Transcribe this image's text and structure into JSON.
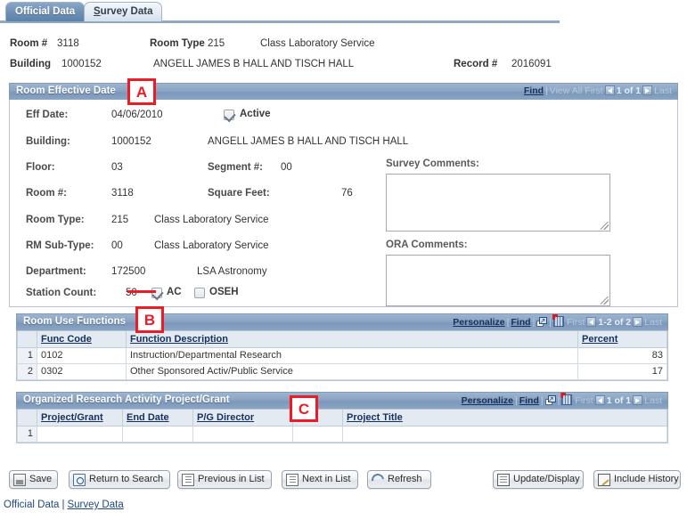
{
  "tabs": [
    {
      "label": "Official Data",
      "active": true
    },
    {
      "label": "Survey Data",
      "active": false,
      "accel": "S"
    }
  ],
  "header": {
    "room_label": "Room #",
    "room_value": "3118",
    "room_type_label": "Room Type",
    "room_type_value": "215",
    "room_type_desc": "Class Laboratory Service",
    "building_label": "Building",
    "building_value": "1000152",
    "building_desc": "ANGELL JAMES B HALL AND TISCH HALL",
    "record_label": "Record #",
    "record_value": "2016091"
  },
  "effective_section": {
    "title": "Room Effective Date",
    "nav": {
      "find": "Find",
      "view_all": "View All",
      "first": "First",
      "counter": "1 of 1",
      "last": "Last"
    },
    "fields": {
      "eff_date_label": "Eff Date:",
      "eff_date_value": "04/06/2010",
      "active_label": "Active",
      "active_checked": true,
      "building_label": "Building:",
      "building_value": "1000152",
      "building_desc": "ANGELL JAMES B HALL AND TISCH HALL",
      "floor_label": "Floor:",
      "floor_value": "03",
      "segment_label": "Segment #:",
      "segment_value": "00",
      "room_label": "Room #:",
      "room_value": "3118",
      "sqft_label": "Square Feet:",
      "sqft_value": "76",
      "room_type_label": "Room Type:",
      "room_type_value": "215",
      "room_type_desc": "Class Laboratory Service",
      "sub_type_label": "RM Sub-Type:",
      "sub_type_value": "00",
      "sub_type_desc": "Class Laboratory Service",
      "department_label": "Department:",
      "department_value": "172500",
      "department_desc": "LSA Astronomy",
      "station_count_label": "Station Count:",
      "station_count_value": "50",
      "ac_label": "AC",
      "ac_checked": true,
      "oseh_label": "OSEH",
      "oseh_checked": false
    },
    "survey_comments_label": "Survey Comments:",
    "survey_comments_value": "",
    "ora_comments_label": "ORA Comments:",
    "ora_comments_value": ""
  },
  "room_use_functions": {
    "title": "Room Use Functions",
    "nav": {
      "personalize": "Personalize",
      "find": "Find",
      "popup_icon": "popup-window-icon",
      "grid_icon": "download-spreadsheet-icon",
      "first": "First",
      "counter": "1-2 of 2",
      "last": "Last"
    },
    "columns": [
      "",
      "Func Code",
      "Function Description",
      "Percent"
    ],
    "rows": [
      {
        "num": "1",
        "func_code": "0102",
        "description": "Instruction/Departmental Research",
        "percent": "83"
      },
      {
        "num": "2",
        "func_code": "0302",
        "description": "Other Sponsored Activ/Public Service",
        "percent": "17"
      }
    ]
  },
  "org_research": {
    "title": "Organized Research Activity Project/Grant",
    "nav": {
      "personalize": "Personalize",
      "find": "Find",
      "popup_icon": "popup-window-icon",
      "grid_icon": "download-spreadsheet-icon",
      "first": "First",
      "counter": "1 of 1",
      "last": "Last"
    },
    "columns": [
      "",
      "Project/Grant",
      "End Date",
      "P/G Director",
      "",
      "Project Title"
    ],
    "rows": [
      {
        "num": "1",
        "project_grant": "",
        "end_date": "",
        "pg_director": "",
        "extra": "",
        "project_title": ""
      }
    ]
  },
  "buttons": [
    {
      "label": "Save",
      "icon": "save-icon"
    },
    {
      "label": "Return to Search",
      "icon": "search-icon"
    },
    {
      "label": "Previous in List",
      "icon": "previous-list-icon"
    },
    {
      "label": "Next in List",
      "icon": "next-list-icon"
    },
    {
      "label": "Refresh",
      "icon": "refresh-icon"
    },
    {
      "label": "Update/Display",
      "icon": "document-icon"
    },
    {
      "label": "Include History",
      "icon": "pencil-icon"
    }
  ],
  "footer_links": {
    "official_data": "Official Data",
    "separator": "|",
    "survey_data": "Survey Data"
  },
  "annotations": [
    {
      "letter": "A"
    },
    {
      "letter": "B"
    },
    {
      "letter": "C"
    }
  ],
  "colors": {
    "section_bar": "#8aa4c3",
    "active_tab": "#6f90b5",
    "link": "#15305c",
    "annotation_red": "#ee1b24",
    "grid_header": "#e4eaf1"
  }
}
